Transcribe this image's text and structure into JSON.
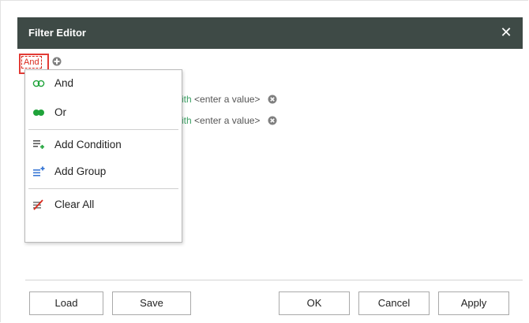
{
  "dialog": {
    "title": "Filter Editor",
    "close_glyph": "✕"
  },
  "editor": {
    "group_operator": "And",
    "conditions": [
      {
        "operator_fragment": "ith",
        "value": "<enter a value>"
      },
      {
        "operator_fragment": "ith",
        "value": "<enter a value>"
      }
    ]
  },
  "context_menu": {
    "items": [
      {
        "label": "And",
        "icon": "and-operator-icon"
      },
      {
        "label": "Or",
        "icon": "or-operator-icon"
      },
      {
        "label": "Add Condition",
        "icon": "add-condition-icon"
      },
      {
        "label": "Add Group",
        "icon": "add-group-icon"
      },
      {
        "label": "Clear All",
        "icon": "clear-all-icon"
      }
    ]
  },
  "footer": {
    "load": "Load",
    "save": "Save",
    "ok": "OK",
    "cancel": "Cancel",
    "apply": "Apply"
  },
  "colors": {
    "titlebar": "#3e4a46",
    "operator_red": "#d9291c",
    "condition_green": "#3aa063",
    "icon_green": "#1fa33a",
    "icon_blue": "#3a78d6"
  }
}
